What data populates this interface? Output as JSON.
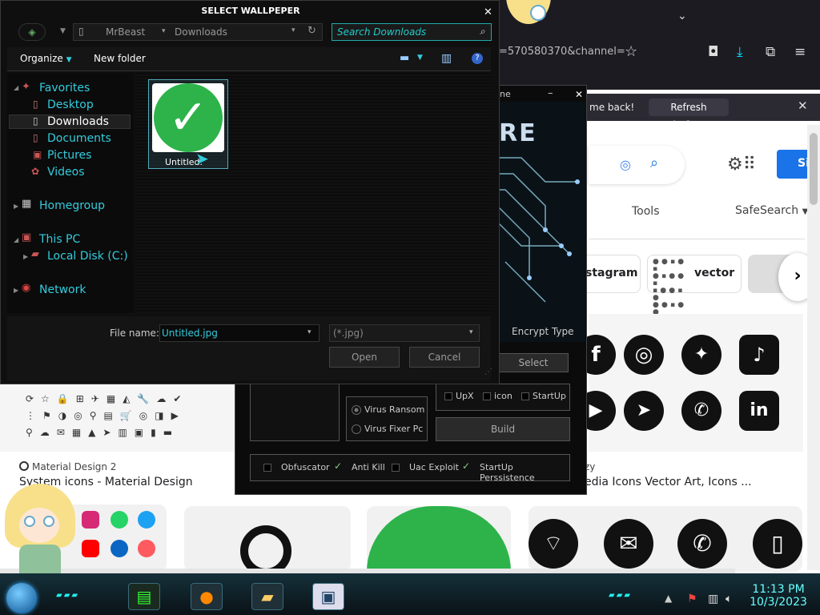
{
  "browser": {
    "url_fragment": "=570580370&channel=",
    "notification": {
      "text": "me back!",
      "button": "Refresh Firefox..."
    },
    "google": {
      "sign_in": "Si",
      "tools": "Tools",
      "safesearch": "SafeSearch",
      "chips": [
        "stagram",
        "vector"
      ],
      "results": {
        "left_source": "Material Design 2",
        "left_title": "System icons - Material Design",
        "right_source": "zy",
        "right_title": "edia Icons Vector Art, Icons ..."
      }
    }
  },
  "builder": {
    "title_fragment": "ne",
    "logo_fragment": "RE",
    "encrypt_type": "Encrypt Type",
    "select": "Select",
    "upx": "UpX",
    "icon": "icon",
    "startup": "StartUp",
    "virus_ransom": "Virus Ransom",
    "virus_fixer": "Virus Fixer Pc",
    "build": "Build",
    "obfuscator": "Obfuscator",
    "anti_kill": "Anti Kill",
    "uac_exploit": "Uac Exploit",
    "startup_persistence": "StartUp Perssistence"
  },
  "dialog": {
    "title": "SELECT WALLPEPER",
    "address": {
      "crumb1": "MrBeast",
      "crumb2": "Downloads"
    },
    "search_placeholder": "Search Downloads",
    "organize": "Organize",
    "new_folder": "New folder",
    "nav": {
      "favorites": "Favorites",
      "desktop": "Desktop",
      "downloads": "Downloads",
      "documents": "Documents",
      "pictures": "Pictures",
      "videos": "Videos",
      "homegroup": "Homegroup",
      "this_pc": "This PC",
      "local_disk": "Local Disk (C:)",
      "network": "Network"
    },
    "file": {
      "name": "Untitled."
    },
    "file_name_label": "File name:",
    "file_name_value": "Untitled.jpg",
    "file_type_value": "(*.jpg)",
    "open": "Open",
    "cancel": "Cancel"
  },
  "taskbar": {
    "time": "11:13 PM",
    "date": "10/3/2023"
  }
}
